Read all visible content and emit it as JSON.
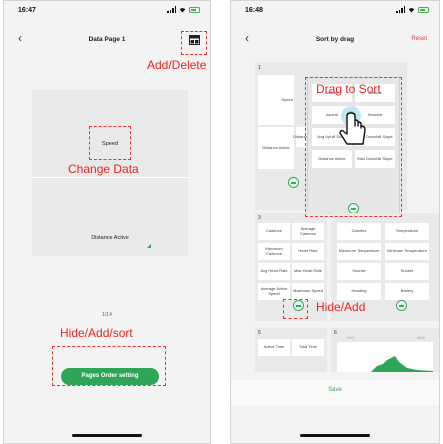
{
  "left_phone": {
    "status_time": "16:47",
    "title": "Data Page 1",
    "speed_label": "Speed",
    "distance_label": "Distance Active",
    "page_indicator": "1/14",
    "pages_order_button": "Pages Order setting"
  },
  "right_phone": {
    "status_time": "16:48",
    "title": "Sort by drag",
    "reset_label": "Reset",
    "page1": {
      "number": "1",
      "left_col": [
        "Speed",
        "Distance Active"
      ],
      "mid_col": [
        "",
        "Distance",
        "Avg Uphill"
      ],
      "drag_cells": [
        "Altitude",
        "Altitude",
        "Ascent",
        "Descent",
        "Avg Uphill Slope",
        "Max Downhill Slope",
        "Distance Active",
        "Max Downhill Slope"
      ]
    },
    "page3": {
      "number": "3",
      "cells": [
        "Cadence",
        "Average Cadence",
        "Maximum Cadence",
        "Heart Rate",
        "Avg Heart Rate",
        "Max Heart Rate",
        "Average Active Speed",
        "Maximum Speed"
      ]
    },
    "page4": {
      "cells": [
        "Calories",
        "Temperature",
        "Maximum Temperature",
        "Minimum Temperature",
        "Sunrise",
        "Sunset",
        "Heading",
        "Battery"
      ]
    },
    "page5": {
      "number": "5",
      "cells": [
        "Active Time",
        "Total Time"
      ]
    },
    "page6": {
      "number": "6",
      "avg": "AVG",
      "max": "MAX"
    },
    "save_label": "Save"
  },
  "annotations": {
    "add_delete": "Add/Delete",
    "change_data": "Change Data",
    "hide_add_sort": "Hide/Add/sort",
    "drag_to_sort": "Drag to Sort",
    "hide_add": "Hide/Add"
  },
  "colors": {
    "accent_green": "#2fa657",
    "annotation_red": "#e22222",
    "reset_red": "#e53e3e"
  }
}
